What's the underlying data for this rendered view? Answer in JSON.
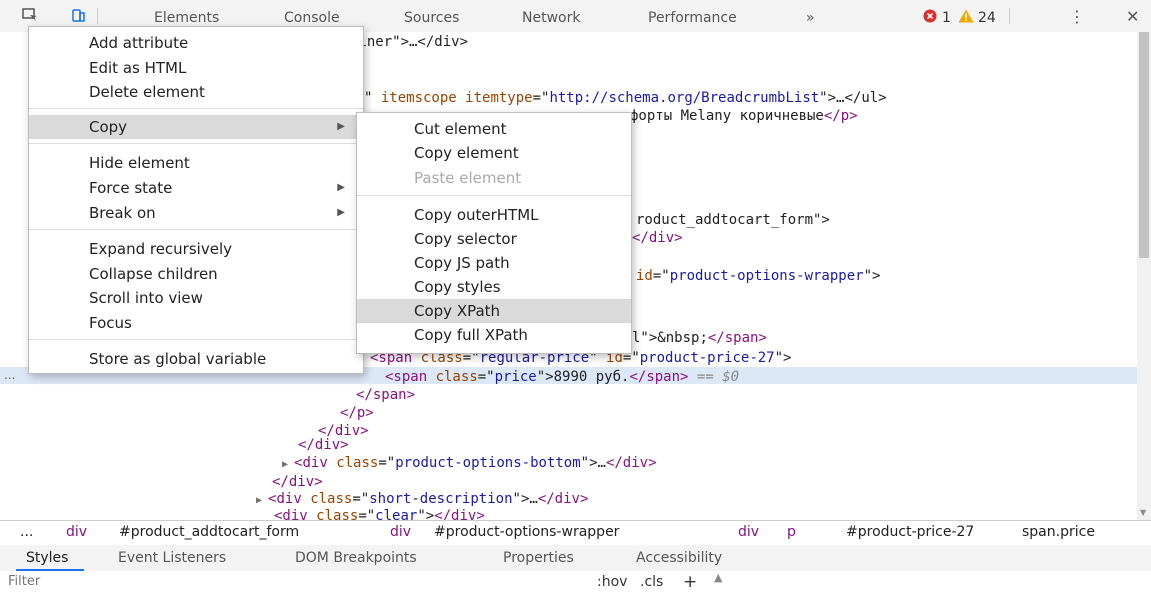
{
  "toolbar": {
    "tabs": [
      "Elements",
      "Console",
      "Sources",
      "Network",
      "Performance"
    ],
    "more": "»",
    "errors": "1",
    "warnings": "24",
    "kebab": "⋮",
    "close": "✕",
    "colors": {
      "error": "#d93025",
      "warning": "#f2a600"
    }
  },
  "tree": {
    "lines": [
      {
        "parts": [
          [
            "txt",
            "ainer\">…</div>"
          ]
        ]
      },
      {
        "parts": [
          [
            "txt",
            "\" "
          ],
          [
            "attr",
            "itemscope"
          ],
          [
            "txt",
            " "
          ],
          [
            "attr",
            "itemtype"
          ],
          [
            "txt",
            "=\""
          ],
          [
            "val",
            "http://schema.org/BreadcrumbList"
          ],
          [
            "txt",
            "\">…</ul>"
          ]
        ]
      },
      {
        "parts": [
          [
            "txt",
            "форты Melany коричневые"
          ],
          [
            "tag",
            "</p>"
          ]
        ]
      },
      {
        "parts": [
          [
            "txt",
            "roduct_addtocart_form\">"
          ]
        ]
      },
      {
        "parts": [
          [
            "tag",
            "</div>"
          ]
        ]
      },
      {
        "parts": [
          [
            "attr",
            "id"
          ],
          [
            "txt",
            "=\""
          ],
          [
            "val",
            "product-options-wrapper"
          ],
          [
            "txt",
            "\">"
          ]
        ]
      },
      {
        "parts": [
          [
            "txt",
            "l\">"
          ],
          [
            "ent",
            "&nbsp;"
          ],
          [
            "tag",
            "</span>"
          ]
        ]
      },
      {
        "parts": [
          [
            "tag",
            "<span "
          ],
          [
            "attr",
            "class"
          ],
          [
            "txt",
            "=\""
          ],
          [
            "val",
            "regular-price"
          ],
          [
            "txt",
            "\" "
          ],
          [
            "attr",
            "id"
          ],
          [
            "txt",
            "=\""
          ],
          [
            "val",
            "product-price-27"
          ],
          [
            "txt",
            "\">"
          ]
        ]
      },
      {
        "parts": [
          [
            "tag",
            "<span "
          ],
          [
            "attr",
            "class"
          ],
          [
            "txt",
            "=\""
          ],
          [
            "val",
            "price"
          ],
          [
            "txt",
            "\">"
          ],
          [
            "txt",
            "8990 руб."
          ],
          [
            "tag",
            "</span>"
          ],
          [
            "txt",
            " == $0"
          ]
        ]
      },
      {
        "parts": [
          [
            "tag",
            "</span>"
          ]
        ]
      },
      {
        "parts": [
          [
            "tag",
            "</p>"
          ]
        ]
      },
      {
        "parts": [
          [
            "tag",
            "</div>"
          ]
        ]
      },
      {
        "parts": [
          [
            "tag",
            "</div>"
          ]
        ]
      },
      {
        "parts": [
          [
            "tri",
            "▶ "
          ],
          [
            "tag",
            "<div "
          ],
          [
            "attr",
            "class"
          ],
          [
            "txt",
            "=\""
          ],
          [
            "val",
            "product-options-bottom"
          ],
          [
            "txt",
            "\">…"
          ],
          [
            "tag",
            "</div>"
          ]
        ]
      },
      {
        "parts": [
          [
            "tag",
            "</div>"
          ]
        ]
      },
      {
        "parts": [
          [
            "tri",
            "▶ "
          ],
          [
            "tag",
            "<div "
          ],
          [
            "attr",
            "class"
          ],
          [
            "txt",
            "=\""
          ],
          [
            "val",
            "short-description"
          ],
          [
            "txt",
            "\">…"
          ],
          [
            "tag",
            "</div>"
          ]
        ]
      },
      {
        "parts": [
          [
            "tag",
            "<div "
          ],
          [
            "attr",
            "class"
          ],
          [
            "txt",
            "=\""
          ],
          [
            "val",
            "clear"
          ],
          [
            "txt",
            "\">"
          ],
          [
            "tag",
            "</div>"
          ]
        ]
      }
    ],
    "ellipsis": "..."
  },
  "breadcrumb": [
    {
      "text": "...",
      "kind": "id"
    },
    {
      "text": "div",
      "kind": "tag"
    },
    {
      "text": "#product_addtocart_form",
      "kind": "id"
    },
    {
      "text": "div",
      "kind": "tag"
    },
    {
      "text": "#product-options-wrapper",
      "kind": "id"
    },
    {
      "text": "div",
      "kind": "tag"
    },
    {
      "text": "p",
      "kind": "tag"
    },
    {
      "text": "#product-price-27",
      "kind": "id"
    },
    {
      "text": "span.price",
      "kind": "id"
    }
  ],
  "bottom_tabs": [
    "Styles",
    "Event Listeners",
    "DOM Breakpoints",
    "Properties",
    "Accessibility"
  ],
  "filter": {
    "placeholder": "Filter",
    "hov": ":hov",
    "cls": ".cls",
    "plus": "+"
  },
  "context_menu": {
    "items": [
      {
        "label": "Add attribute"
      },
      {
        "label": "Edit as HTML"
      },
      {
        "label": "Delete element"
      },
      {
        "sep": true
      },
      {
        "label": "Copy",
        "submenu": true,
        "highlight": true
      },
      {
        "sep": true
      },
      {
        "label": "Hide element"
      },
      {
        "label": "Force state",
        "submenu": true
      },
      {
        "label": "Break on",
        "submenu": true
      },
      {
        "sep": true
      },
      {
        "label": "Expand recursively"
      },
      {
        "label": "Collapse children"
      },
      {
        "label": "Scroll into view"
      },
      {
        "label": "Focus"
      },
      {
        "sep": true
      },
      {
        "label": "Store as global variable"
      }
    ]
  },
  "copy_submenu": {
    "items": [
      {
        "label": "Cut element"
      },
      {
        "label": "Copy element"
      },
      {
        "label": "Paste element",
        "disabled": true
      },
      {
        "sep": true
      },
      {
        "label": "Copy outerHTML"
      },
      {
        "label": "Copy selector"
      },
      {
        "label": "Copy JS path"
      },
      {
        "label": "Copy styles"
      },
      {
        "label": "Copy XPath",
        "highlight": true
      },
      {
        "label": "Copy full XPath"
      }
    ]
  }
}
